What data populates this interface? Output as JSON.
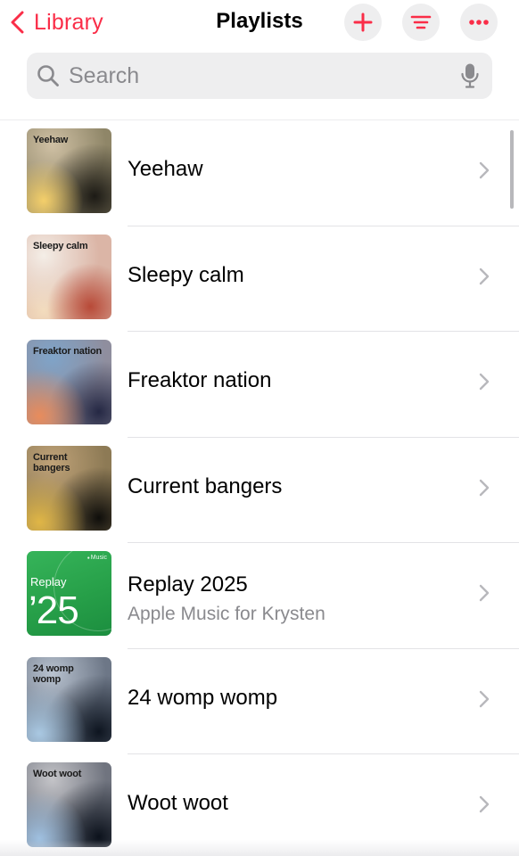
{
  "header": {
    "back_label": "Library",
    "title": "Playlists",
    "icons": {
      "back": "chevron-left-icon",
      "add": "plus-icon",
      "sort": "sort-lines-icon",
      "more": "ellipsis-icon"
    }
  },
  "search": {
    "placeholder": "Search",
    "icons": {
      "search": "magnifier-icon",
      "voice": "microphone-icon"
    }
  },
  "colors": {
    "accent": "#fa2d48",
    "button_bg": "#eeeeef",
    "secondary_text": "#8a8a8e"
  },
  "playlists": [
    {
      "title": "Yeehaw",
      "art_label": "Yeehaw"
    },
    {
      "title": "Sleepy calm",
      "art_label": "Sleepy calm"
    },
    {
      "title": "Freaktor nation",
      "art_label": "Freaktor nation"
    },
    {
      "title": "Current bangers",
      "art_label": "Current\nbangers"
    },
    {
      "title": "Replay 2025",
      "subtitle": "Apple Music for Krysten",
      "art_word": "Replay",
      "art_year": "’25",
      "art_brand": "Music"
    },
    {
      "title": "24 womp womp",
      "art_label": "24 womp\nwomp"
    },
    {
      "title": "Woot woot",
      "art_label": "Woot woot"
    }
  ]
}
